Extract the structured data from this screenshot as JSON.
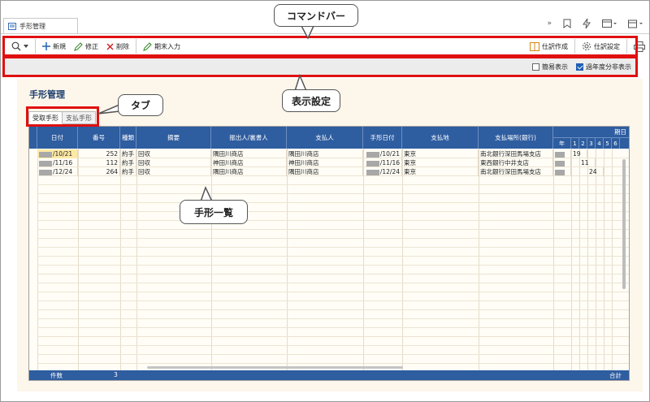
{
  "window": {
    "tab_title": "手形管理"
  },
  "toolbar": {
    "new_label": "新規",
    "edit_label": "修正",
    "delete_label": "削除",
    "period_end_label": "期末入力",
    "journal_create_label": "仕訳作成",
    "journal_settings_label": "仕訳設定"
  },
  "display": {
    "simple_label": "簡易表示",
    "simple_checked": false,
    "past_hidden_label": "過年度分非表示",
    "past_hidden_checked": true
  },
  "page": {
    "title": "手形管理"
  },
  "tabs": [
    {
      "label": "受取手形",
      "active": true
    },
    {
      "label": "支払手形",
      "active": false
    }
  ],
  "table": {
    "headers": {
      "date": "日付",
      "number": "番号",
      "kind": "種類",
      "summary": "摘要",
      "issuer": "振出人/裏書人",
      "payer": "支払人",
      "bill_date": "手形日付",
      "pay_place": "支払地",
      "pay_location": "支払場所(銀行)",
      "due": "期日",
      "year": "年",
      "d1": "1",
      "d2": "2",
      "d3": "3",
      "d4": "4",
      "d5": "5",
      "d6": "6"
    },
    "rows": [
      {
        "date": "/10/21",
        "number": "252",
        "kind": "約手",
        "summary": "回収",
        "issuer": "隅田川商店",
        "payer": "隅田川商店",
        "bill_date": "/10/21",
        "pay_place": "東京",
        "pay_location": "南北銀行深田馬場支店",
        "due_day": "19"
      },
      {
        "date": "/11/16",
        "number": "112",
        "kind": "約手",
        "summary": "回収",
        "issuer": "神田川商店",
        "payer": "神田川商店",
        "bill_date": "/11/16",
        "pay_place": "東京",
        "pay_location": "東西銀行中井支店",
        "due_day": "11"
      },
      {
        "date": "/12/24",
        "number": "264",
        "kind": "約手",
        "summary": "回収",
        "issuer": "隅田川商店",
        "payer": "隅田川商店",
        "bill_date": "/12/24",
        "pay_place": "東京",
        "pay_location": "南北銀行深田馬場支店",
        "due_day": "24"
      }
    ],
    "footer": {
      "count_label": "件数",
      "count": "3",
      "total_label": "合計"
    }
  },
  "callouts": {
    "command_bar": "コマンドバー",
    "display_settings": "表示設定",
    "tab": "タブ",
    "bill_list": "手形一覧"
  },
  "colors": {
    "header_blue": "#2e5da0",
    "highlight_red": "#e01010",
    "content_bg": "#fdf6ea"
  }
}
